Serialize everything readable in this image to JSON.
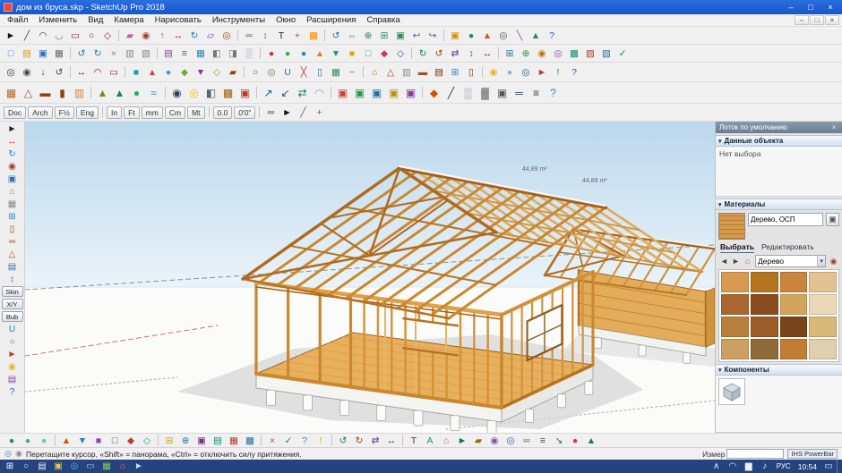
{
  "window": {
    "title": "дом из бруса.skp - SketchUp Pro 2018",
    "controls_icons": [
      [
        "minimize-window",
        "–",
        "#ffffff"
      ],
      [
        "maximize-window",
        "□",
        "#ffffff"
      ],
      [
        "close-window",
        "×",
        "#ffffff"
      ]
    ]
  },
  "menu": {
    "items": [
      "Файл",
      "Изменить",
      "Вид",
      "Камера",
      "Нарисовать",
      "Инструменты",
      "Окно",
      "Расширения",
      "Справка"
    ],
    "doc_controls": [
      [
        "doc-minimize",
        "–",
        "#444444"
      ],
      [
        "doc-restore",
        "□",
        "#444444"
      ],
      [
        "doc-close",
        "×",
        "#444444"
      ]
    ]
  },
  "toolbars": {
    "row1": [
      [
        "select",
        "►",
        "#111111"
      ],
      [
        "line",
        "╱",
        "#444444"
      ],
      [
        "arc",
        "◠",
        "#444444"
      ],
      [
        "freehand",
        "◡",
        "#666666"
      ],
      [
        "rectangle",
        "▭",
        "#8b2020"
      ],
      [
        "circle",
        "○",
        "#8b2020"
      ],
      [
        "polygon",
        "◇",
        "#8b2020"
      ],
      [
        "sep"
      ],
      [
        "eraser",
        "▰",
        "#c75b9b"
      ],
      [
        "paint-bucket",
        "◉",
        "#a03c2e"
      ],
      [
        "push-pull",
        "↑",
        "#b5411f"
      ],
      [
        "move",
        "↔",
        "#cc2222"
      ],
      [
        "rotate",
        "↻",
        "#2277cc"
      ],
      [
        "scale",
        "▱",
        "#7a3f9d"
      ],
      [
        "offset",
        "◎",
        "#b5411f"
      ],
      [
        "sep"
      ],
      [
        "tape-measure",
        "═",
        "#666666"
      ],
      [
        "dimension",
        "↕",
        "#336699"
      ],
      [
        "text",
        "T",
        "#222222"
      ],
      [
        "axes",
        "+",
        "#cc3333"
      ],
      [
        "section-plane",
        "▩",
        "#ff8c00"
      ],
      [
        "sep"
      ],
      [
        "orbit",
        "↺",
        "#1f6fbf"
      ],
      [
        "pan",
        "⇔",
        "#2e8b57"
      ],
      [
        "zoom",
        "⊕",
        "#2e8b57"
      ],
      [
        "zoom-window",
        "⊞",
        "#2e8b57"
      ],
      [
        "zoom-extents",
        "▣",
        "#2e8b57"
      ],
      [
        "previous-view",
        "↩",
        "#3a6fb0"
      ],
      [
        "next-view",
        "↪",
        "#3a6fb0"
      ],
      [
        "sep"
      ],
      [
        "cube-tool",
        "▣",
        "#d98e04"
      ],
      [
        "sphere-tool",
        "●",
        "#2e8b57"
      ],
      [
        "cone-tool",
        "▲",
        "#cc5522"
      ],
      [
        "gear-tool",
        "◎",
        "#555555"
      ],
      [
        "magic-wand",
        "╲",
        "#8e44ad"
      ],
      [
        "tree-tool",
        "▲",
        "#1e8449"
      ],
      [
        "help",
        "?",
        "#2255cc"
      ]
    ],
    "row2": [
      [
        "new-file",
        "□",
        "#4a90d9"
      ],
      [
        "open-file",
        "▤",
        "#d4a017"
      ],
      [
        "save",
        "▣",
        "#2e6fb7"
      ],
      [
        "print",
        "▦",
        "#666666"
      ],
      [
        "sep"
      ],
      [
        "undo",
        "↺",
        "#3a6fb0"
      ],
      [
        "redo",
        "↻",
        "#3a6fb0"
      ],
      [
        "cut",
        "×",
        "#888888"
      ],
      [
        "copy",
        "▥",
        "#888888"
      ],
      [
        "paste",
        "▧",
        "#888888"
      ],
      [
        "sep"
      ],
      [
        "layer-manager",
        "▤",
        "#8e44ad"
      ],
      [
        "outliner",
        "≡",
        "#555555"
      ],
      [
        "scenes",
        "▦",
        "#2e86c1"
      ],
      [
        "styles-manager",
        "◧",
        "#777777"
      ],
      [
        "shadows-toggle",
        "◨",
        "#777777"
      ],
      [
        "fog",
        "▒",
        "#9ab0c4"
      ],
      [
        "sep"
      ],
      [
        "red-plugin",
        "●",
        "#c0392b"
      ],
      [
        "green-plugin",
        "●",
        "#27ae60"
      ],
      [
        "blue-plugin",
        "●",
        "#2980b9"
      ],
      [
        "orange-plugin",
        "▲",
        "#e67e22"
      ],
      [
        "teal-plugin",
        "▼",
        "#16a085"
      ],
      [
        "yellow-plugin",
        "■",
        "#d4ac0d"
      ],
      [
        "gray-plugin",
        "□",
        "#7f8c8d"
      ],
      [
        "pink-plugin",
        "◆",
        "#cc3366"
      ],
      [
        "navy-plugin",
        "◇",
        "#2255aa"
      ],
      [
        "sep"
      ],
      [
        "rotate-cw",
        "↻",
        "#117a65"
      ],
      [
        "rotate-ccw",
        "↺",
        "#a04000"
      ],
      [
        "swap",
        "⇄",
        "#6c3483"
      ],
      [
        "stretch-v",
        "↕",
        "#1a5276"
      ],
      [
        "stretch-h",
        "↔",
        "#7b241c"
      ],
      [
        "sep"
      ],
      [
        "grid-plugin",
        "⊞",
        "#2874a6"
      ],
      [
        "add-plugin",
        "⊕",
        "#239b56"
      ],
      [
        "target-plugin",
        "◉",
        "#b9770e"
      ],
      [
        "ring-plugin",
        "◎",
        "#884ea0"
      ],
      [
        "hatch-plugin",
        "▩",
        "#148f77"
      ],
      [
        "shade-plugin",
        "▨",
        "#b03a2e"
      ],
      [
        "diag-plugin",
        "▧",
        "#2471a3"
      ],
      [
        "check-plugin",
        "✓",
        "#1e8449"
      ]
    ],
    "row3": [
      [
        "camera-plugin",
        "◎",
        "#333333"
      ],
      [
        "position-camera",
        "◉",
        "#444444"
      ],
      [
        "walk-tool",
        "↓",
        "#444444"
      ],
      [
        "look-around",
        "↺",
        "#444444"
      ],
      [
        "sep"
      ],
      [
        "dim-plugin",
        "↔",
        "#8b2020"
      ],
      [
        "angle-plugin",
        "◠",
        "#8b2020"
      ],
      [
        "area-plugin",
        "▭",
        "#8b2020"
      ],
      [
        "sep"
      ],
      [
        "cyan-tool",
        "■",
        "#17a2a8"
      ],
      [
        "red-tool",
        "▲",
        "#cc4444"
      ],
      [
        "steel-tool",
        "●",
        "#5588cc"
      ],
      [
        "lime-tool",
        "◆",
        "#77aa33"
      ],
      [
        "violet-tool",
        "▼",
        "#7d3c98"
      ],
      [
        "gold-tool",
        "◇",
        "#b7950b"
      ],
      [
        "rust-tool",
        "▰",
        "#a04000"
      ],
      [
        "sep"
      ],
      [
        "pipe-plugin",
        "○",
        "#555555"
      ],
      [
        "tube-plugin",
        "◎",
        "#777777"
      ],
      [
        "weld-plugin",
        "U",
        "#2277aa"
      ],
      [
        "split-plugin",
        "╳",
        "#aa3355"
      ],
      [
        "mirror-plugin",
        "▯",
        "#336699"
      ],
      [
        "array-plugin",
        "▦",
        "#2e8b57"
      ],
      [
        "path-plugin",
        "~",
        "#8e44ad"
      ],
      [
        "sep"
      ],
      [
        "house-plugin",
        "⌂",
        "#b5651d"
      ],
      [
        "roof-plugin",
        "△",
        "#8b4513"
      ],
      [
        "wall-plugin",
        "▥",
        "#7f8c8d"
      ],
      [
        "floor-plugin",
        "▬",
        "#a0522d"
      ],
      [
        "stairs-plugin",
        "▤",
        "#6e2c00"
      ],
      [
        "window-plugin",
        "⊞",
        "#2e86c1"
      ],
      [
        "door-plugin",
        "▯",
        "#784212"
      ],
      [
        "sep"
      ],
      [
        "sun-plugin",
        "◉",
        "#e6b422"
      ],
      [
        "moon-plugin",
        "●",
        "#9ab0c4"
      ],
      [
        "globe-plugin",
        "◎",
        "#1f618d"
      ],
      [
        "flag-plugin",
        "►",
        "#c0392b"
      ],
      [
        "info-plugin",
        "!",
        "#2874a6"
      ],
      [
        "query-plugin",
        "?",
        "#6c3483"
      ]
    ],
    "row4": [
      [
        "framing-plugin",
        "▦",
        "#b5651d"
      ],
      [
        "truss-plugin",
        "△",
        "#a0522d"
      ],
      [
        "beam-plugin",
        "▬",
        "#8b4513"
      ],
      [
        "post-plugin",
        "▮",
        "#8b4513"
      ],
      [
        "panel-plugin",
        "▥",
        "#cd853f"
      ],
      [
        "sep"
      ],
      [
        "terrain-plugin",
        "▲",
        "#6b8e23"
      ],
      [
        "tree-plugin",
        "▲",
        "#1e8449"
      ],
      [
        "shrub-plugin",
        "●",
        "#27ae60"
      ],
      [
        "water-plugin",
        "≈",
        "#2e86c1"
      ],
      [
        "sep"
      ],
      [
        "render-plugin",
        "◉",
        "#2e4053"
      ],
      [
        "light-plugin",
        "◎",
        "#f1c40f"
      ],
      [
        "shadow-plugin",
        "◧",
        "#566573"
      ],
      [
        "texture-plugin",
        "▩",
        "#9c640c"
      ],
      [
        "color-plugin",
        "▣",
        "#c0392b"
      ],
      [
        "sep"
      ],
      [
        "export-plugin",
        "↗",
        "#1a5276"
      ],
      [
        "import-plugin",
        "↙",
        "#1a5276"
      ],
      [
        "sync-plugin",
        "⇄",
        "#117a65"
      ],
      [
        "cloud-plugin",
        "◠",
        "#5dade2"
      ],
      [
        "sep"
      ],
      [
        "cube-red",
        "▣",
        "#cb4335"
      ],
      [
        "cube-green",
        "▣",
        "#229954"
      ],
      [
        "cube-blue",
        "▣",
        "#2471a3"
      ],
      [
        "cube-gold",
        "▣",
        "#b7950b"
      ],
      [
        "cube-purple",
        "▣",
        "#7d3c98"
      ],
      [
        "sep"
      ],
      [
        "select-face",
        "◆",
        "#d35400"
      ],
      [
        "select-edge",
        "╱",
        "#2c3e50"
      ],
      [
        "hide-tool",
        "▒",
        "#95a5a6"
      ],
      [
        "unhide-tool",
        "▓",
        "#717d7e"
      ],
      [
        "lock-tool",
        "▣",
        "#515a5a"
      ],
      [
        "measure-tool",
        "═",
        "#34495e"
      ],
      [
        "settings-tool",
        "≡",
        "#2c3e50"
      ],
      [
        "about-tool",
        "?",
        "#2e86c1"
      ]
    ],
    "units": [
      [
        "doc-units",
        "Doc",
        "#333333",
        "t"
      ],
      [
        "arch-units",
        "Arch",
        "#333333",
        "t"
      ],
      [
        "fraction-units",
        "F½",
        "#333333",
        "t"
      ],
      [
        "eng-units",
        "Eng",
        "#333333",
        "t"
      ],
      [
        "sep"
      ],
      [
        "inch-units",
        "In",
        "#333333",
        "t"
      ],
      [
        "feet-units",
        "Ft",
        "#333333",
        "t"
      ],
      [
        "mm-units",
        "mm",
        "#333333",
        "t"
      ],
      [
        "cm-units",
        "Cm",
        "#333333",
        "t"
      ],
      [
        "meter-units",
        "Mt",
        "#333333",
        "t"
      ],
      [
        "sep"
      ],
      [
        "decimal-display",
        "0.0",
        "#333333",
        "t"
      ],
      [
        "feet-inch-display",
        "0'0\"",
        "#333333",
        "t"
      ],
      [
        "sep"
      ],
      [
        "dim-style",
        "═",
        "#8b2020"
      ],
      [
        "arrow-tool",
        "►",
        "#111111"
      ],
      [
        "pencil-tool",
        "╱",
        "#8e44ad"
      ],
      [
        "axes-tool",
        "+",
        "#cc3333"
      ]
    ]
  },
  "left_toolbar": {
    "items": [
      [
        "lt-select",
        "►",
        "#222222"
      ],
      [
        "lt-move",
        "↔",
        "#cc2222"
      ],
      [
        "lt-rotate",
        "↻",
        "#2277cc"
      ],
      [
        "lt-paint",
        "◉",
        "#a03c2e"
      ],
      [
        "lt-cube",
        "▣",
        "#2e6fb7"
      ],
      [
        "lt-roof",
        "⌂",
        "#b5651d"
      ],
      [
        "lt-wall",
        "▦",
        "#888888"
      ],
      [
        "lt-window",
        "⊞",
        "#2e86c1"
      ],
      [
        "lt-door",
        "▯",
        "#8b4513"
      ],
      [
        "lt-beam",
        "═",
        "#a0522d"
      ],
      [
        "lt-truss",
        "△",
        "#a0522d"
      ],
      [
        "lt-grid",
        "▤",
        "#3a6fb0"
      ],
      [
        "lt-dimension",
        "↕",
        "#336699"
      ],
      [
        "skin-button",
        "Skin",
        "#333333",
        "t"
      ],
      [
        "xy-button",
        "X/Y",
        "#333333",
        "t"
      ],
      [
        "bub-button",
        "Bub",
        "#333333",
        "t"
      ],
      [
        "lt-weld",
        "U",
        "#2277aa"
      ],
      [
        "lt-pipe",
        "○",
        "#555555"
      ],
      [
        "lt-flag",
        "►",
        "#c0392b"
      ],
      [
        "lt-sun",
        "◉",
        "#e6b422"
      ],
      [
        "lt-layers",
        "▤",
        "#8e44ad"
      ],
      [
        "lt-help",
        "?",
        "#2255cc"
      ]
    ]
  },
  "viewport": {
    "area_labels": [
      "44,89 m²",
      "44,89 m²"
    ]
  },
  "tray": {
    "title": "Лоток по умолчанию",
    "close_glyph": "×",
    "entity": {
      "title": "Данные объекта",
      "empty_text": "Нет выбора"
    },
    "materials": {
      "title": "Материалы",
      "name": "Дерево, ОСП",
      "create_glyph": "▣",
      "tabs": [
        "Выбрать",
        "Редактировать"
      ],
      "nav_icons": [
        [
          "back",
          "◄",
          "#444444"
        ],
        [
          "forward",
          "►",
          "#444444"
        ],
        [
          "in-model",
          "⌂",
          "#b5651d"
        ]
      ],
      "dropdown": "Дерево",
      "dropdown_arrow": "▾",
      "sample_icons": [
        [
          "sample-paint",
          "◉",
          "#a03c2e"
        ]
      ],
      "swatches": [
        "#d89a52",
        "#b5741f",
        "#c8853b",
        "#e3c193",
        "#aa6630",
        "#8a4a1f",
        "#d2a45e",
        "#ead9b8",
        "#b97f3c",
        "#9c5c28",
        "#7a4418",
        "#d9b878",
        "#caa163",
        "#8f6b3a",
        "#c27c33",
        "#e0cfae"
      ]
    },
    "components": {
      "title": "Компоненты"
    },
    "section_arrow": "▾"
  },
  "bottom_toolbar": {
    "items": [
      [
        "render-preset-1",
        "●",
        "#2e8b57"
      ],
      [
        "render-preset-2",
        "●",
        "#3cb371"
      ],
      [
        "render-preset-3",
        "●",
        "#66cdaa"
      ],
      [
        "sep"
      ],
      [
        "bt-tri-orange",
        "▲",
        "#d35400"
      ],
      [
        "bt-tri-blue",
        "▼",
        "#2980b9"
      ],
      [
        "bt-sq-purple",
        "■",
        "#8e44ad"
      ],
      [
        "bt-sq-gray",
        "□",
        "#555555"
      ],
      [
        "bt-di-red",
        "◆",
        "#c0392b"
      ],
      [
        "bt-di-teal",
        "◇",
        "#16a085"
      ],
      [
        "sep"
      ],
      [
        "bt-grid",
        "⊞",
        "#d4ac0d"
      ],
      [
        "bt-plus",
        "⊕",
        "#2874a6"
      ],
      [
        "bt-square",
        "▣",
        "#6c3483"
      ],
      [
        "bt-rows",
        "▤",
        "#148f77"
      ],
      [
        "bt-hatch",
        "▦",
        "#b03a2e"
      ],
      [
        "bt-dense",
        "▩",
        "#2471a3"
      ],
      [
        "sep"
      ],
      [
        "bt-close",
        "×",
        "#cb4335"
      ],
      [
        "bt-check",
        "✓",
        "#1e8449"
      ],
      [
        "bt-question",
        "?",
        "#2e86c1"
      ],
      [
        "bt-exclaim",
        "!",
        "#d4a017"
      ],
      [
        "sep"
      ],
      [
        "bt-ccw",
        "↺",
        "#117a65"
      ],
      [
        "bt-cw",
        "↻",
        "#a04000"
      ],
      [
        "bt-swap",
        "⇄",
        "#6c3483"
      ],
      [
        "bt-horizontal",
        "↔",
        "#1a5276"
      ],
      [
        "sep"
      ],
      [
        "bt-text",
        "T",
        "#7b241c"
      ],
      [
        "bt-annotate",
        "A",
        "#239b56"
      ],
      [
        "bt-home",
        "⌂",
        "#b5651d"
      ],
      [
        "bt-play",
        "►",
        "#196f3d"
      ],
      [
        "bt-bar",
        "▰",
        "#9c640c"
      ],
      [
        "bt-target",
        "◉",
        "#884ea0"
      ],
      [
        "bt-ring",
        "◎",
        "#2e6fb7"
      ],
      [
        "bt-equal",
        "═",
        "#666666"
      ],
      [
        "bt-menu",
        "≡",
        "#444444"
      ],
      [
        "bt-arrow",
        "↘",
        "#1f618d"
      ],
      [
        "bt-dot",
        "●",
        "#cc3366"
      ],
      [
        "bt-triangle",
        "▲",
        "#117a65"
      ]
    ]
  },
  "statusbar": {
    "icons": [
      [
        "geolocation",
        "◎",
        "#2e86c1"
      ],
      [
        "credits",
        "◉",
        "#888888"
      ]
    ],
    "hint": "Перетащите курсор, «Shift» = панорама, «Ctrl» = отключить силу притяжения.",
    "measure_label": "Измер",
    "powerbar": "IHS PowerBar"
  },
  "taskbar": {
    "left_icons": [
      [
        "start",
        "⊞",
        "#ffffff"
      ],
      [
        "search",
        "○",
        "#e8eef6"
      ],
      [
        "task-view",
        "▤",
        "#e8eef6"
      ],
      [
        "file-explorer",
        "▣",
        "#f3c244"
      ],
      [
        "browser",
        "◎",
        "#58b0e8"
      ],
      [
        "mail",
        "▭",
        "#9fc5e8"
      ],
      [
        "photos",
        "▦",
        "#7fd14f"
      ],
      [
        "sketchup-taskbar",
        "⌂",
        "#ff6b52"
      ],
      [
        "media-player",
        "►",
        "#c8d8f0"
      ]
    ],
    "tray_icons": [
      [
        "hidden-icons",
        "∧",
        "#e8eef6"
      ],
      [
        "onedrive",
        "◠",
        "#e8eef6"
      ],
      [
        "network",
        "▆",
        "#e8eef6"
      ],
      [
        "volume",
        "♪",
        "#e8eef6"
      ]
    ],
    "lang": "РУС",
    "time": "10:54",
    "right_icons": [
      [
        "action-center",
        "▭",
        "#e8eef6"
      ]
    ]
  }
}
